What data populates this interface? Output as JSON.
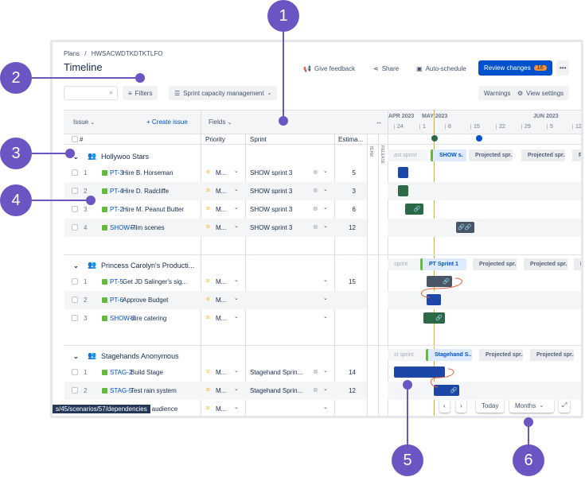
{
  "breadcrumb": {
    "root": "Plans",
    "separator": "/",
    "plan": "HWSACWDTKDTKTLFO"
  },
  "title": "Timeline",
  "header_actions": {
    "feedback": "Give feedback",
    "share": "Share",
    "auto_schedule": "Auto-schedule",
    "review": "Review changes",
    "review_count": "16",
    "more": "•••"
  },
  "toolbar": {
    "search_placeholder": "",
    "filters": "Filters",
    "capacity": "Sprint capacity management",
    "warnings": "Warnings",
    "view_settings": "View settings"
  },
  "table_header": {
    "issue": "Issue",
    "create_issue": "Create issue",
    "fields": "Fields",
    "hash": "#",
    "priority": "Priority",
    "sprint": "Sprint",
    "estimate": "Estima...",
    "team": "TEAM",
    "release": "RELEASE"
  },
  "timeline_header": {
    "months": [
      "APR 2023",
      "MAY 2023",
      "JUN 2023"
    ],
    "weeks": [
      "24",
      "1",
      "8",
      "15",
      "22",
      "29",
      "5",
      "12"
    ],
    "today": "2023-05-04"
  },
  "colors": {
    "accent": "#0052cc",
    "today_line": "#f5a623",
    "story": "#63ba3c",
    "bar_blue": "#1d47a6",
    "bar_green": "#2c6a47",
    "bar_gray": "#4a5568",
    "callout": "#6a55c2",
    "dependency": "#f0643c"
  },
  "groups": [
    {
      "name": "Hollywoo Stars",
      "sprints": [
        "ast sprint",
        "SHOW s.",
        "Projected spr...",
        "Projected spr...",
        "Pro"
      ],
      "rows": [
        {
          "n": "1",
          "key": "PT-3",
          "title": "Hire B. Horseman",
          "priority": "M...",
          "sprint": "SHOW sprint 3",
          "estimate": "5",
          "bar": {
            "start": "2023-04-25",
            "end": "2023-04-28",
            "color": "blue",
            "links": 0
          }
        },
        {
          "n": "2",
          "key": "PT-4",
          "title": "Hire D. Radcliffe",
          "priority": "M...",
          "sprint": "SHOW sprint 3",
          "estimate": "3",
          "bar": {
            "start": "2023-04-25",
            "end": "2023-04-28",
            "color": "green",
            "links": 0
          }
        },
        {
          "n": "3",
          "key": "PT-2",
          "title": "Hire M. Peanut Butter",
          "priority": "M...",
          "sprint": "SHOW sprint 3",
          "estimate": "6",
          "bar": {
            "start": "2023-04-27",
            "end": "2023-05-02",
            "color": "green",
            "links": 1
          }
        },
        {
          "n": "4",
          "key": "SHOW-7",
          "title": "Film scenes",
          "priority": "M...",
          "sprint": "SHOW sprint 3",
          "estimate": "12",
          "bar": {
            "start": "2023-05-11",
            "end": "2023-05-16",
            "color": "gray",
            "links": 2
          }
        }
      ]
    },
    {
      "name": "Princess Carolyn's Producti...",
      "sprints": [
        "sprint",
        "PT Sprint 1",
        "Projected spr...",
        "Projected spr...",
        "P"
      ],
      "rows": [
        {
          "n": "1",
          "key": "PT-5",
          "title": "Get JD Salinger's sig...",
          "priority": "M...",
          "sprint": "",
          "estimate": "15",
          "bar": {
            "start": "2023-05-03",
            "end": "2023-05-10",
            "color": "gray",
            "links": 1
          }
        },
        {
          "n": "2",
          "key": "PT-6",
          "title": "Approve Budget",
          "priority": "M...",
          "sprint": "",
          "estimate": "",
          "bar": {
            "start": "2023-05-03",
            "end": "2023-05-07",
            "color": "blue",
            "links": 0
          }
        },
        {
          "n": "3",
          "key": "SHOW-2",
          "title": "Hire catering",
          "priority": "M...",
          "sprint": "",
          "estimate": "",
          "bar": {
            "start": "2023-05-02",
            "end": "2023-05-08",
            "color": "green",
            "links": 1
          }
        }
      ]
    },
    {
      "name": "Stagehands Anonymous",
      "sprints": [
        "st sprint",
        "Stagehand S..",
        "Projected spr...",
        "Projected spr...",
        ""
      ],
      "rows": [
        {
          "n": "1",
          "key": "STAG-2",
          "title": "Build Stage",
          "priority": "M...",
          "sprint": "Stagehand Sprin...",
          "estimate": "14",
          "bar": {
            "start": "2023-04-24",
            "end": "2023-05-08",
            "color": "blue",
            "links": 0
          }
        },
        {
          "n": "2",
          "key": "STAG-5",
          "title": "Test rain system",
          "priority": "M...",
          "sprint": "Stagehand Sprin...",
          "estimate": "12",
          "bar": {
            "start": "2023-05-05",
            "end": "2023-05-12",
            "color": "blue",
            "links": 1
          }
        },
        {
          "n": "3",
          "key": "SHOW-3",
          "title": "Gather audience",
          "priority": "M...",
          "sprint": "",
          "estimate": "",
          "bar": null
        }
      ]
    }
  ],
  "nav": {
    "prev": "‹",
    "next": "›",
    "today": "Today",
    "scale": "Months"
  },
  "status_url": "s/45/scenarios/57/dependencies",
  "callouts": [
    "1",
    "2",
    "3",
    "4",
    "5",
    "6"
  ]
}
